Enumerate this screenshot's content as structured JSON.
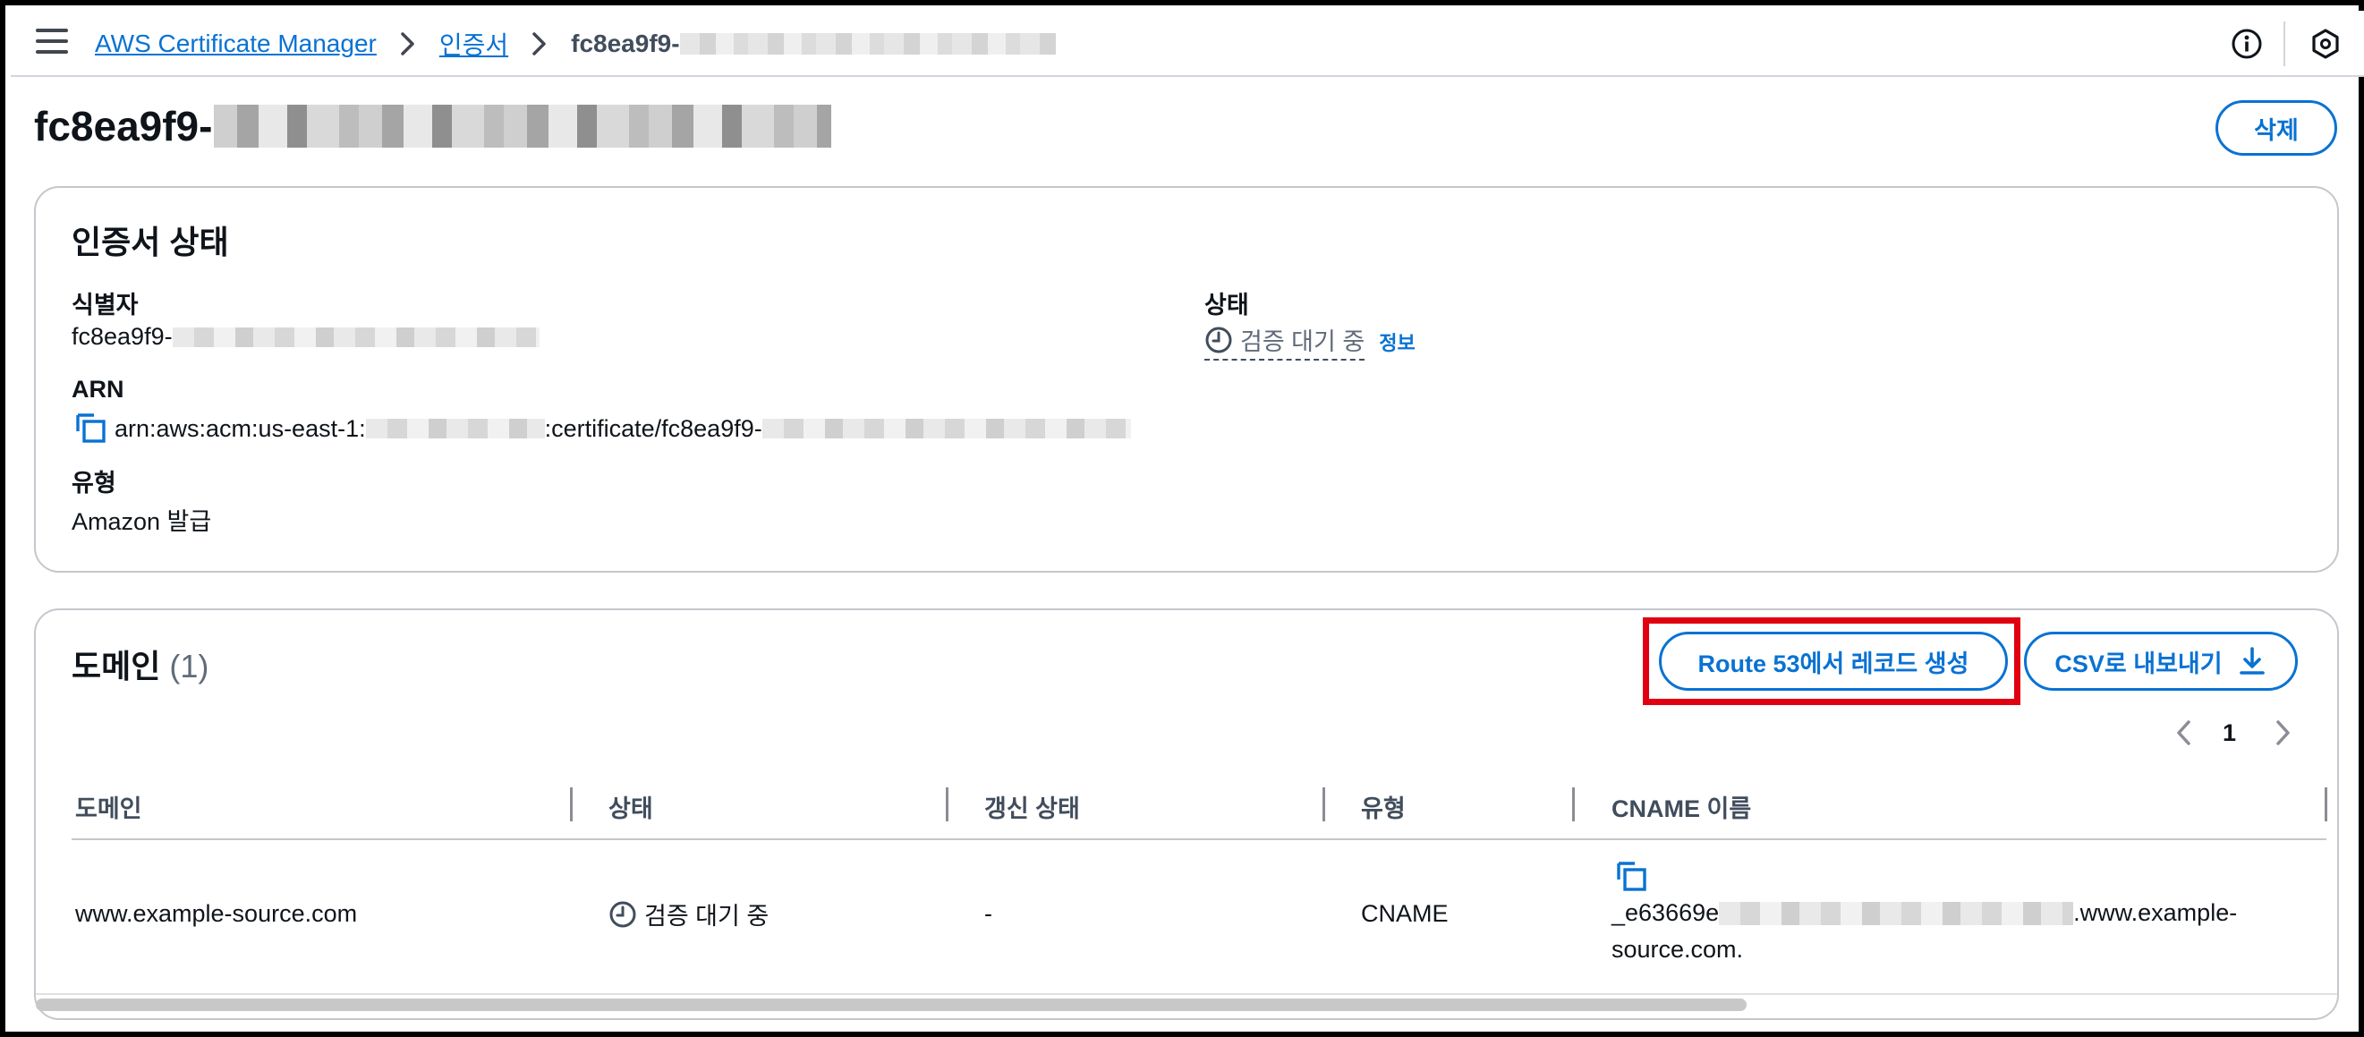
{
  "breadcrumb": {
    "service": "AWS Certificate Manager",
    "section": "인증서",
    "current": "fc8ea9f9-"
  },
  "page": {
    "title_prefix": "fc8ea9f9-",
    "delete_label": "삭제"
  },
  "cert_status": {
    "heading": "인증서 상태",
    "identifier_label": "식별자",
    "identifier_value": "fc8ea9f9-",
    "arn_label": "ARN",
    "arn_prefix": "arn:aws:acm:us-east-1:",
    "arn_middle": ":certificate/fc8ea9f9-",
    "type_label": "유형",
    "type_value": "Amazon 발급",
    "status_label": "상태",
    "status_value": "검증 대기 중",
    "info_label": "정보"
  },
  "domains": {
    "heading": "도메인",
    "count": "(1)",
    "route53_button": "Route 53에서 레코드 생성",
    "export_button": "CSV로 내보내기",
    "page_number": "1",
    "columns": [
      "도메인",
      "상태",
      "갱신 상태",
      "유형",
      "CNAME 이름"
    ],
    "rows": [
      {
        "domain": "www.example-source.com",
        "status": "검증 대기 중",
        "renewal_status": "-",
        "type": "CNAME",
        "cname_prefix": "_e63669e",
        "cname_suffix": ".www.example-",
        "cname_line2": "source.com."
      }
    ]
  },
  "colors": {
    "link": "#0972d3",
    "highlight": "#e0000f",
    "pending": "#5f6b7a"
  }
}
